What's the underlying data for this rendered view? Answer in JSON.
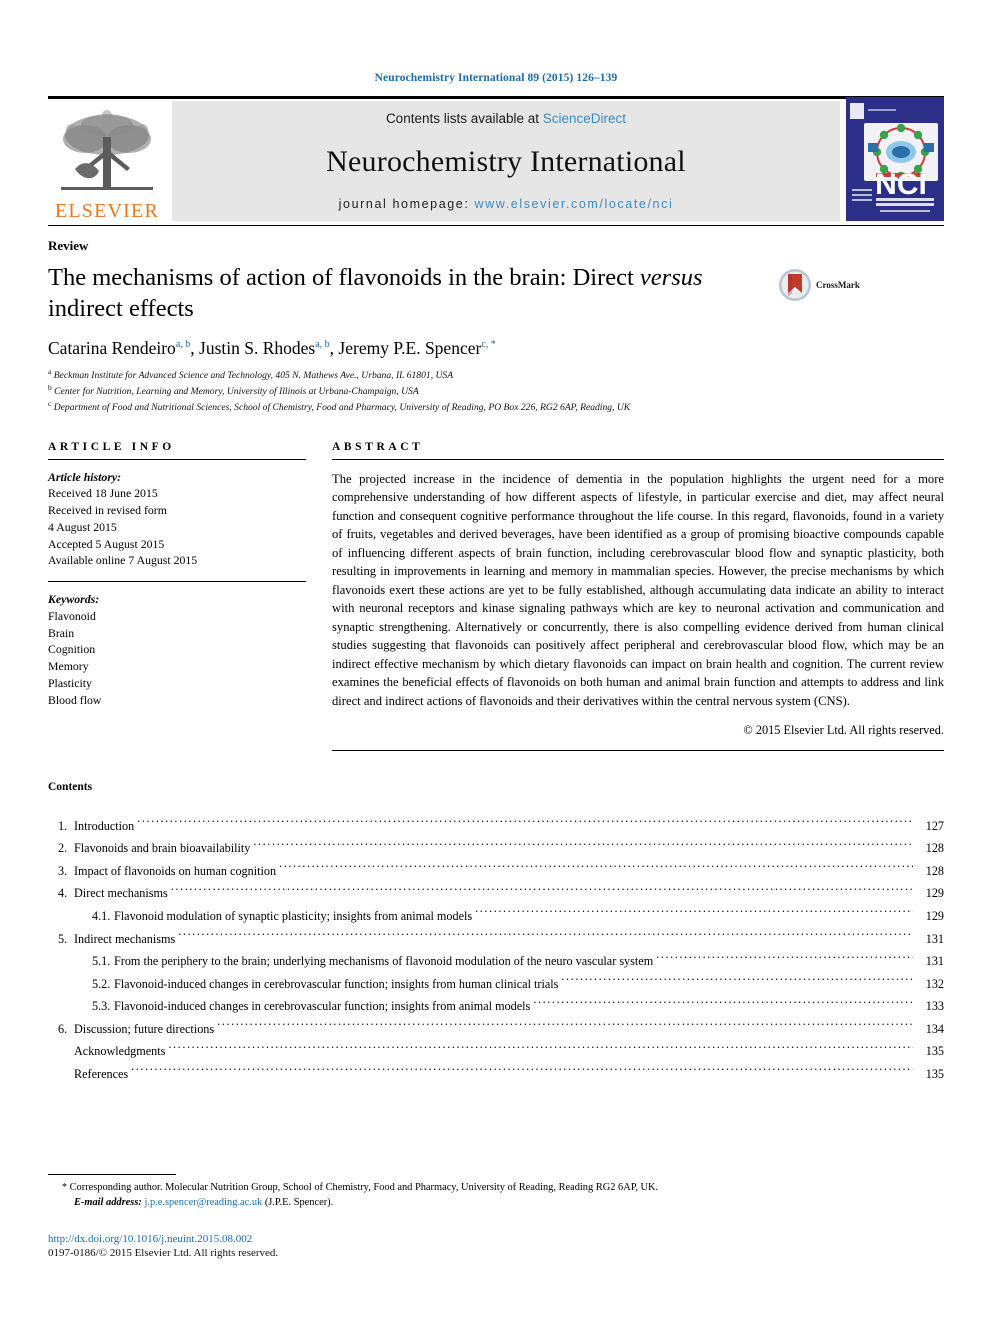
{
  "running_head": "Neurochemistry International 89 (2015) 126–139",
  "masthead": {
    "contents_prefix": "Contents lists available at ",
    "sciencedirect": "ScienceDirect",
    "journal_name": "Neurochemistry International",
    "homepage_prefix": "journal homepage: ",
    "homepage_url": "www.elsevier.com/locate/nci",
    "publisher": "ELSEVIER",
    "cover_title": "NCI",
    "cover_sub1": "NEUROCHEMISTRY",
    "cover_sub2": "INTERNATIONAL"
  },
  "crossmark": {
    "label": "CrossMark"
  },
  "article": {
    "doc_type": "Review",
    "title_part1": "The mechanisms of action of flavonoids in the brain: Direct ",
    "title_italic": "versus",
    "title_part2": " indirect effects",
    "authors": "Catarina Rendeiro, Justin S. Rhodes, Jeremy P.E. Spencer",
    "author_list": [
      {
        "name": "Catarina Rendeiro",
        "marks": "a, b",
        "sep": ", "
      },
      {
        "name": "Justin S. Rhodes",
        "marks": "a, b",
        "sep": ", "
      },
      {
        "name": "Jeremy P.E. Spencer",
        "marks": "c, *",
        "sep": ""
      }
    ],
    "affiliations": [
      {
        "mark": "a",
        "text": "Beckman Institute for Advanced Science and Technology, 405 N. Mathews Ave., Urbana, IL 61801, USA"
      },
      {
        "mark": "b",
        "text": "Center for Nutrition, Learning and Memory, University of Illinois at Urbana-Champaign, USA"
      },
      {
        "mark": "c",
        "text": "Department of Food and Nutritional Sciences, School of Chemistry, Food and Pharmacy, University of Reading, PO Box 226, RG2 6AP, Reading, UK"
      }
    ]
  },
  "article_info": {
    "heading": "ARTICLE INFO",
    "history_label": "Article history:",
    "history": [
      "Received 18 June 2015",
      "Received in revised form",
      "4 August 2015",
      "Accepted 5 August 2015",
      "Available online 7 August 2015"
    ],
    "keywords_label": "Keywords:",
    "keywords": [
      "Flavonoid",
      "Brain",
      "Cognition",
      "Memory",
      "Plasticity",
      "Blood flow"
    ]
  },
  "abstract": {
    "heading": "ABSTRACT",
    "body": "The projected increase in the incidence of dementia in the population highlights the urgent need for a more comprehensive understanding of how different aspects of lifestyle, in particular exercise and diet, may affect neural function and consequent cognitive performance throughout the life course. In this regard, flavonoids, found in a variety of fruits, vegetables and derived beverages, have been identified as a group of promising bioactive compounds capable of influencing different aspects of brain function, including cerebrovascular blood flow and synaptic plasticity, both resulting in improvements in learning and memory in mammalian species. However, the precise mechanisms by which flavonoids exert these actions are yet to be fully established, although accumulating data indicate an ability to interact with neuronal receptors and kinase signaling pathways which are key to neuronal activation and communication and synaptic strengthening. Alternatively or concurrently, there is also compelling evidence derived from human clinical studies suggesting that flavonoids can positively affect peripheral and cerebrovascular blood flow, which may be an indirect effective mechanism by which dietary flavonoids can impact on brain health and cognition. The current review examines the beneficial effects of flavonoids on both human and animal brain function and attempts to address and link direct and indirect actions of flavonoids and their derivatives within the central nervous system (CNS).",
    "copyright": "© 2015 Elsevier Ltd. All rights reserved."
  },
  "contents": {
    "heading": "Contents",
    "entries": [
      {
        "num": "1.",
        "label": "Introduction",
        "page": "127",
        "sub": false
      },
      {
        "num": "2.",
        "label": "Flavonoids and brain bioavailability",
        "page": "128",
        "sub": false
      },
      {
        "num": "3.",
        "label": "Impact of flavonoids on human cognition",
        "page": "128",
        "sub": false
      },
      {
        "num": "4.",
        "label": "Direct mechanisms",
        "page": "129",
        "sub": false
      },
      {
        "num": "4.1.",
        "label": "Flavonoid modulation of synaptic plasticity; insights from animal models",
        "page": "129",
        "sub": true
      },
      {
        "num": "5.",
        "label": "Indirect mechanisms",
        "page": "131",
        "sub": false
      },
      {
        "num": "5.1.",
        "label": "From the periphery to the brain; underlying mechanisms of flavonoid modulation of the neuro vascular system",
        "page": "131",
        "sub": true
      },
      {
        "num": "5.2.",
        "label": "Flavonoid-induced changes in cerebrovascular function; insights from human clinical trials",
        "page": "132",
        "sub": true
      },
      {
        "num": "5.3.",
        "label": "Flavonoid-induced changes in cerebrovascular function; insights from animal models",
        "page": "133",
        "sub": true
      },
      {
        "num": "6.",
        "label": "Discussion; future directions",
        "page": "134",
        "sub": false
      },
      {
        "num": "",
        "label": "Acknowledgments",
        "page": "135",
        "sub": false
      },
      {
        "num": "",
        "label": "References",
        "page": "135",
        "sub": false
      }
    ]
  },
  "footer": {
    "corresponding_star": "*",
    "corresponding": "Corresponding author. Molecular Nutrition Group, School of Chemistry, Food and Pharmacy, University of Reading, Reading RG2 6AP, UK.",
    "email_label": "E-mail address:",
    "email": "j.p.e.spencer@reading.ac.uk",
    "email_owner": "(J.P.E. Spencer).",
    "doi": "http://dx.doi.org/10.1016/j.neuint.2015.08.002",
    "issn": "0197-0186/© 2015 Elsevier Ltd. All rights reserved."
  },
  "colors": {
    "link_blue": "#1b6ca8",
    "sciencedirect_blue": "#3b8bc4",
    "elsevier_orange": "#e87722",
    "masthead_gray": "#e6e6e6"
  }
}
